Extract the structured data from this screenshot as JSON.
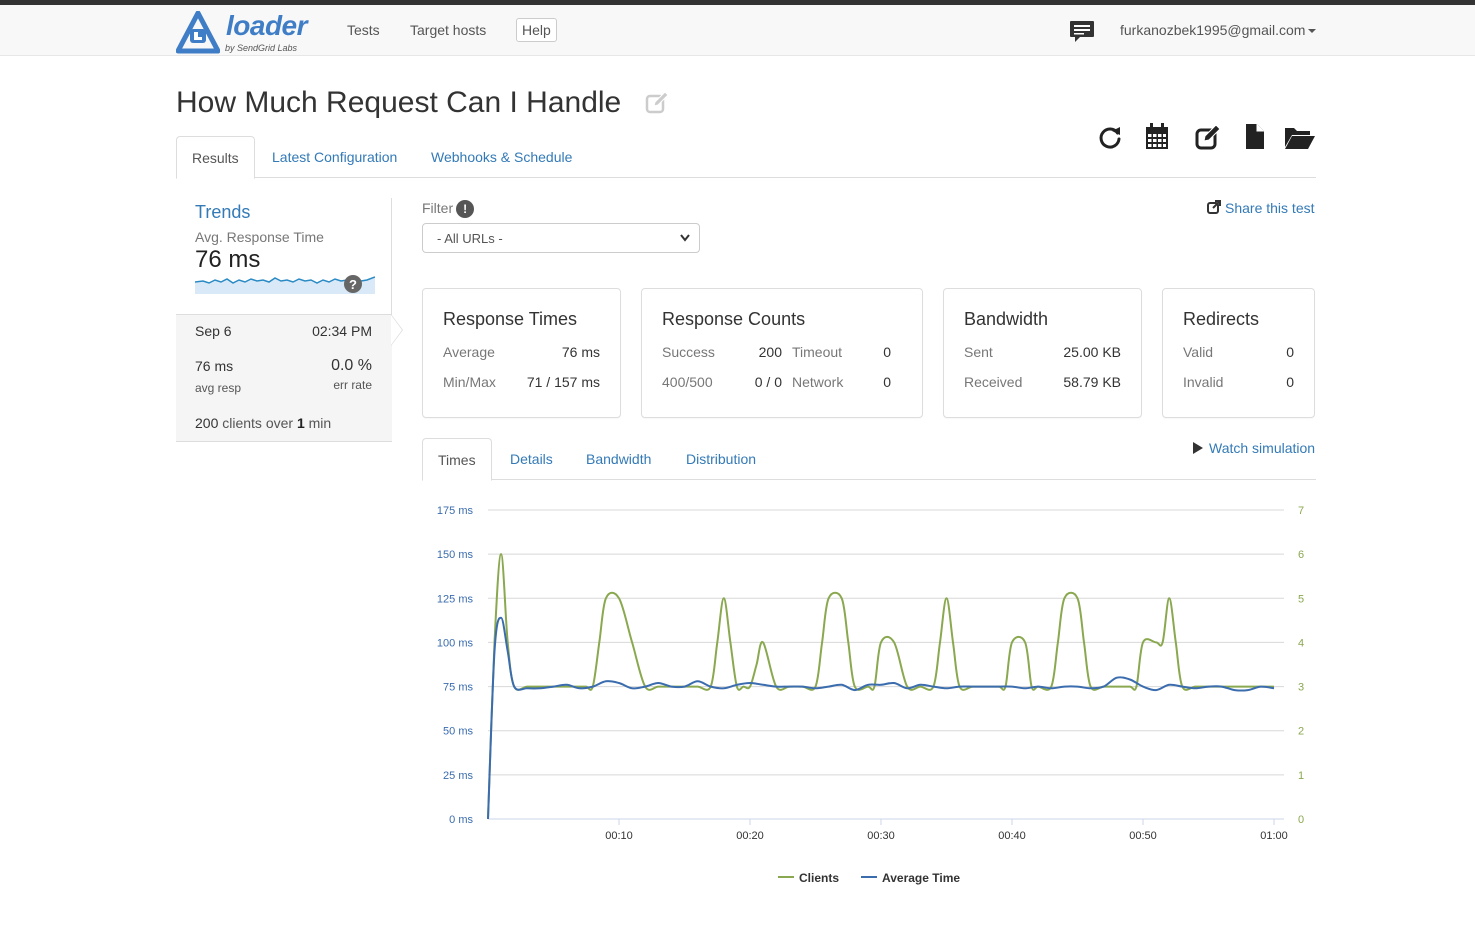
{
  "nav": {
    "logo_word": "loader",
    "logo_sub": "by SendGrid Labs",
    "links": [
      "Tests",
      "Target hosts"
    ],
    "help": "Help",
    "user": "furkanozbek1995@gmail.com",
    "icons": {
      "messages": "chat-icon",
      "menu": "caret-down-icon"
    }
  },
  "page": {
    "title": "How Much Request Can I Handle",
    "tabs": [
      "Results",
      "Latest Configuration",
      "Webhooks & Schedule"
    ],
    "active_tab": "Results",
    "toolbar_icons": [
      "refresh-icon",
      "calendar-icon",
      "edit-icon",
      "file-icon",
      "folder-open-icon"
    ]
  },
  "sidebar": {
    "title": "Trends",
    "metric": "Avg. Response Time",
    "value": "76 ms",
    "help": "?",
    "run": {
      "date": "Sep 6",
      "time": "02:34 PM",
      "avg": "76 ms",
      "avg_label": "avg resp",
      "err": "0.0 %",
      "err_label": "err rate",
      "summary_count": "200",
      "summary_mid": " clients over ",
      "summary_dur": "1",
      "summary_unit": " min"
    }
  },
  "filter": {
    "label": "Filter",
    "info": "!",
    "selected": "- All URLs -",
    "share": "Share this test"
  },
  "cards": {
    "response_times": {
      "title": "Response Times",
      "avg_label": "Average",
      "avg": "76 ms",
      "minmax_label": "Min/Max",
      "minmax": "71 / 157 ms"
    },
    "response_counts": {
      "title": "Response Counts",
      "success_label": "Success",
      "success": "200",
      "timeout_label": "Timeout",
      "timeout": "0",
      "err_label": "400/500",
      "err": "0 / 0",
      "network_label": "Network",
      "network": "0"
    },
    "bandwidth": {
      "title": "Bandwidth",
      "sent_label": "Sent",
      "sent": "25.00 KB",
      "recv_label": "Received",
      "recv": "58.79 KB"
    },
    "redirects": {
      "title": "Redirects",
      "valid_label": "Valid",
      "valid": "0",
      "invalid_label": "Invalid",
      "invalid": "0"
    }
  },
  "chart_tabs": [
    "Times",
    "Details",
    "Bandwidth",
    "Distribution"
  ],
  "chart_active_tab": "Times",
  "watch": "Watch simulation",
  "colors": {
    "clients": "#8aa84f",
    "avg_time": "#3b6cae",
    "link": "#337ab7"
  },
  "chart_data": {
    "type": "line",
    "x_ticks": [
      "00:10",
      "00:20",
      "00:30",
      "00:40",
      "00:50",
      "01:00"
    ],
    "y_left_ticks": [
      "0 ms",
      "25 ms",
      "50 ms",
      "75 ms",
      "100 ms",
      "125 ms",
      "150 ms",
      "175 ms"
    ],
    "y_right_ticks": [
      "0",
      "1",
      "2",
      "3",
      "4",
      "5",
      "6",
      "7"
    ],
    "xlim": [
      0,
      60
    ],
    "ylim_left": [
      0,
      175
    ],
    "ylim_right": [
      0,
      7
    ],
    "grid": true,
    "legend_position": "bottom",
    "series": [
      {
        "name": "Clients",
        "axis": "right",
        "x": [
          0,
          0.5,
          1,
          1.5,
          2,
          3,
          4,
          5,
          6,
          7,
          7.5,
          8,
          8.5,
          9,
          10,
          11,
          12,
          13,
          14,
          15,
          16,
          17,
          17.5,
          18,
          18.5,
          19,
          19.5,
          20,
          20.5,
          21,
          22,
          23,
          24,
          25,
          25.5,
          26,
          27,
          27.5,
          28,
          29,
          29.5,
          30,
          31,
          32,
          33,
          34,
          34.5,
          35,
          35.5,
          36,
          37,
          38,
          39,
          39.5,
          40,
          41,
          41.5,
          42,
          43,
          43.5,
          44,
          45,
          45.5,
          46,
          47,
          48,
          49,
          49.5,
          50,
          51,
          51.5,
          52,
          52.5,
          53,
          54,
          55,
          56,
          57,
          58,
          59,
          60
        ],
        "values": [
          0,
          4,
          6,
          4,
          3,
          3,
          3,
          3,
          3,
          3,
          3,
          3,
          4,
          5,
          5,
          4,
          3,
          3,
          3,
          3,
          3,
          3,
          4,
          5,
          4,
          3,
          3,
          3,
          3.5,
          4,
          3,
          3,
          3,
          3,
          4,
          5,
          5,
          4,
          3,
          3,
          3,
          4,
          4,
          3,
          3,
          3,
          4,
          5,
          4,
          3,
          3,
          3,
          3,
          3,
          4,
          4,
          3,
          3,
          3,
          4,
          5,
          5,
          4,
          3,
          3,
          3,
          3,
          3,
          4,
          4,
          4,
          5,
          4,
          3,
          3,
          3,
          3,
          3,
          3,
          3,
          3
        ]
      },
      {
        "name": "Average Time",
        "axis": "left",
        "x": [
          0,
          0.5,
          1,
          1.5,
          2,
          3,
          4,
          5,
          6,
          7,
          8,
          9,
          10,
          11,
          12,
          13,
          14,
          15,
          16,
          17,
          18,
          19,
          20,
          21,
          22,
          23,
          24,
          25,
          26,
          27,
          28,
          29,
          30,
          31,
          32,
          33,
          34,
          35,
          36,
          37,
          38,
          39,
          40,
          41,
          42,
          43,
          44,
          45,
          46,
          47,
          48,
          49,
          50,
          51,
          52,
          53,
          54,
          55,
          56,
          57,
          58,
          59,
          60
        ],
        "values": [
          0,
          95,
          114,
          95,
          75,
          74,
          74,
          75,
          76,
          74,
          75,
          78,
          77,
          74,
          75,
          77,
          75,
          75,
          78,
          75,
          74,
          76,
          77,
          76,
          75,
          75,
          75,
          74,
          75,
          76,
          73,
          76,
          76,
          77,
          74,
          76,
          75,
          74,
          75,
          75,
          75,
          75,
          75,
          74,
          75,
          74,
          75,
          75,
          74,
          75,
          80,
          79,
          75,
          73,
          76,
          75,
          74,
          75,
          75,
          73,
          73,
          75,
          74
        ]
      }
    ]
  }
}
